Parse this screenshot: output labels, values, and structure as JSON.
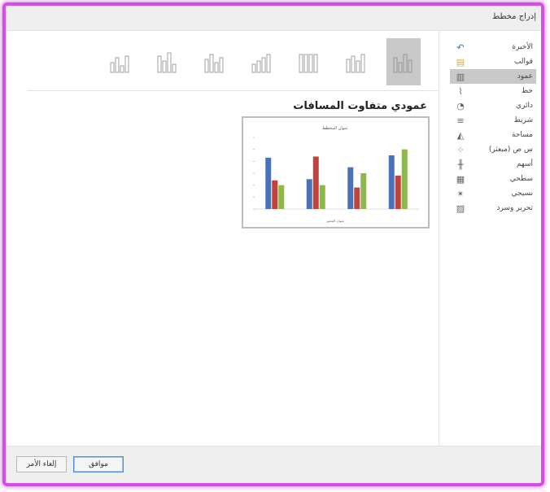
{
  "dialog": {
    "title": "إدراج مخطط"
  },
  "categories": [
    {
      "label": "الأخيرة",
      "icon": "undo-icon",
      "selected": false
    },
    {
      "label": "قوالب",
      "icon": "folder-icon",
      "selected": false
    },
    {
      "label": "عمود",
      "icon": "column-chart-icon",
      "selected": true
    },
    {
      "label": "خط",
      "icon": "line-chart-icon",
      "selected": false
    },
    {
      "label": "دائري",
      "icon": "pie-chart-icon",
      "selected": false
    },
    {
      "label": "شريط",
      "icon": "bar-chart-icon",
      "selected": false
    },
    {
      "label": "مساحة",
      "icon": "area-chart-icon",
      "selected": false
    },
    {
      "label": "س ص (مبعثر)",
      "icon": "scatter-chart-icon",
      "selected": false
    },
    {
      "label": "أسهم",
      "icon": "stock-chart-icon",
      "selected": false
    },
    {
      "label": "سطحي",
      "icon": "surface-chart-icon",
      "selected": false
    },
    {
      "label": "نسيجي",
      "icon": "radar-chart-icon",
      "selected": false
    },
    {
      "label": "تحرير وسرد",
      "icon": "combo-chart-icon",
      "selected": false
    }
  ],
  "subtypes": [
    {
      "name": "3d-column",
      "selected": false
    },
    {
      "name": "3d-100-stacked-column",
      "selected": false
    },
    {
      "name": "3d-stacked-column",
      "selected": false
    },
    {
      "name": "3d-clustered-column",
      "selected": false
    },
    {
      "name": "100-stacked-column",
      "selected": false
    },
    {
      "name": "stacked-column",
      "selected": false
    },
    {
      "name": "clustered-column",
      "selected": true
    }
  ],
  "selected_subtype": {
    "title": "عمودي متفاوت المسافات"
  },
  "preview": {
    "title": "عنوان المخطط",
    "axis_title": "عنوان المحور",
    "colors": [
      "#4a72b8",
      "#c0433d",
      "#8fb84a"
    ]
  },
  "chart_data": {
    "type": "bar",
    "title": "عنوان المخطط",
    "categories": [
      "",
      "",
      "",
      ""
    ],
    "series": [
      {
        "values": [
          4.3,
          2.5,
          3.5,
          4.5
        ]
      },
      {
        "values": [
          2.4,
          4.4,
          1.8,
          2.8
        ]
      },
      {
        "values": [
          2,
          2,
          3,
          5
        ]
      }
    ],
    "ylim": [
      0,
      6
    ],
    "legend": "bottom"
  },
  "buttons": {
    "ok": "موافق",
    "cancel": "إلغاء الأمر"
  }
}
